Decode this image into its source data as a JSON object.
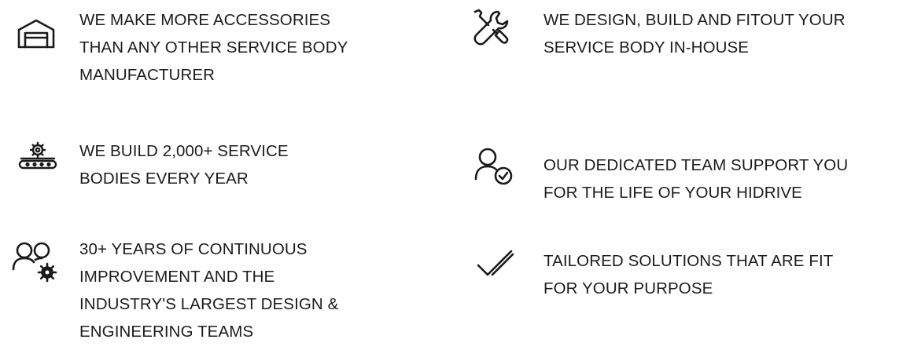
{
  "features": [
    {
      "icon": "warehouse-icon",
      "text": "WE MAKE MORE ACCESSORIES\nTHAN ANY OTHER SERVICE BODY\nMANUFACTURER"
    },
    {
      "icon": "gear-conveyor-icon",
      "text": "WE BUILD 2,000+ SERVICE\nBODIES EVERY YEAR"
    },
    {
      "icon": "team-gear-icon",
      "text": "30+ YEARS OF CONTINUOUS\nIMPROVEMENT AND THE\nINDUSTRY'S LARGEST DESIGN &\nENGINEERING TEAMS"
    },
    {
      "icon": "tools-wrench-screwdriver-icon",
      "text": "WE DESIGN, BUILD AND FITOUT YOUR\nSERVICE BODY IN-HOUSE"
    },
    {
      "icon": "user-check-icon",
      "text": "OUR DEDICATED TEAM SUPPORT YOU\nFOR THE LIFE OF YOUR HIDRIVE"
    },
    {
      "icon": "double-check-icon",
      "text": "TAILORED SOLUTIONS THAT ARE FIT\nFOR YOUR PURPOSE"
    }
  ]
}
